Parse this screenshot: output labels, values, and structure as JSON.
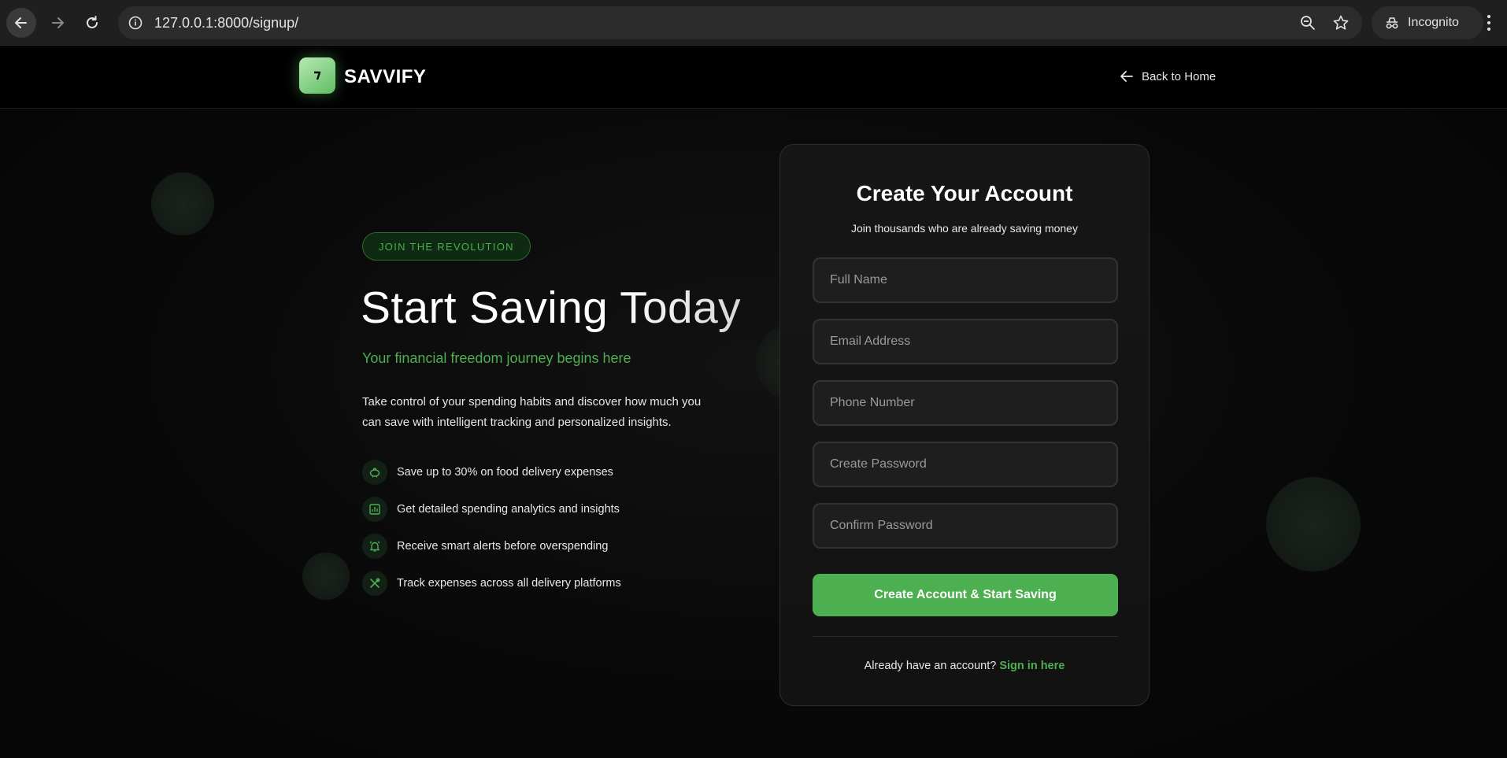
{
  "browser": {
    "url": "127.0.0.1:8000/signup/",
    "incognito_label": "Incognito",
    "icons": [
      "back-arrow-icon",
      "forward-arrow-icon",
      "reload-icon",
      "site-info-icon",
      "zoom-icon",
      "bookmark-star-icon",
      "incognito-icon",
      "kebab-menu-icon"
    ]
  },
  "header": {
    "brand": "SAVVIFY",
    "back_link": "Back to Home"
  },
  "hero": {
    "badge": "JOIN THE REVOLUTION",
    "title": "Start Saving Today",
    "subtitle": "Your financial freedom journey begins here",
    "description": "Take control of your spending habits and discover how much you can save with intelligent tracking and personalized insights.",
    "features": [
      {
        "icon": "piggy-bank-icon",
        "text": "Save up to 30% on food delivery expenses"
      },
      {
        "icon": "analytics-chart-icon",
        "text": "Get detailed spending analytics and insights"
      },
      {
        "icon": "alarm-bell-icon",
        "text": "Receive smart alerts before overspending"
      },
      {
        "icon": "utensils-icon",
        "text": "Track expenses across all delivery platforms"
      }
    ]
  },
  "form": {
    "title": "Create Your Account",
    "subtitle": "Join thousands who are already saving money",
    "fields": {
      "full_name": {
        "placeholder": "Full Name",
        "value": ""
      },
      "email": {
        "placeholder": "Email Address",
        "value": ""
      },
      "phone": {
        "placeholder": "Phone Number",
        "value": ""
      },
      "password": {
        "placeholder": "Create Password",
        "value": ""
      },
      "confirm_password": {
        "placeholder": "Confirm Password",
        "value": ""
      }
    },
    "submit_label": "Create Account & Start Saving",
    "signin_prompt": "Already have an account?",
    "signin_link": "Sign in here"
  },
  "colors": {
    "accent": "#4caf50",
    "background": "#000000",
    "card": "#141414",
    "input": "#1e1e1e"
  }
}
